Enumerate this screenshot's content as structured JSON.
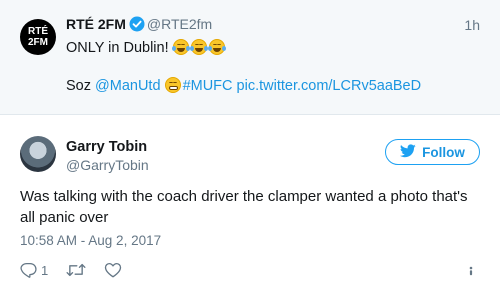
{
  "quoted_tweet": {
    "avatar_text_1": "RTÉ",
    "avatar_text_2": "2FM",
    "name": "RTÉ 2FM",
    "handle": "@RTE2fm",
    "time": "1h",
    "text_line1": "ONLY in Dublin!",
    "soz": "Soz",
    "mention": "@ManUtd",
    "hashtag": "#MUFC",
    "link": "pic.twitter.com/LCRv5aaBeD",
    "icons": [
      "verified-badge-icon",
      "laughing-tears-emoji",
      "grimacing-emoji"
    ]
  },
  "author": {
    "name": "Garry Tobin",
    "handle": "@GarryTobin"
  },
  "follow_button": {
    "label": "Follow",
    "color": "#1da1f2"
  },
  "tweet": {
    "text": "Was talking with the coach driver the clamper wanted a photo that's all panic over",
    "timestamp": "10:58 AM - Aug 2, 2017"
  },
  "actions": {
    "reply_count": "1",
    "icons": [
      "reply-icon",
      "retweet-icon",
      "like-icon",
      "info-icon"
    ]
  }
}
